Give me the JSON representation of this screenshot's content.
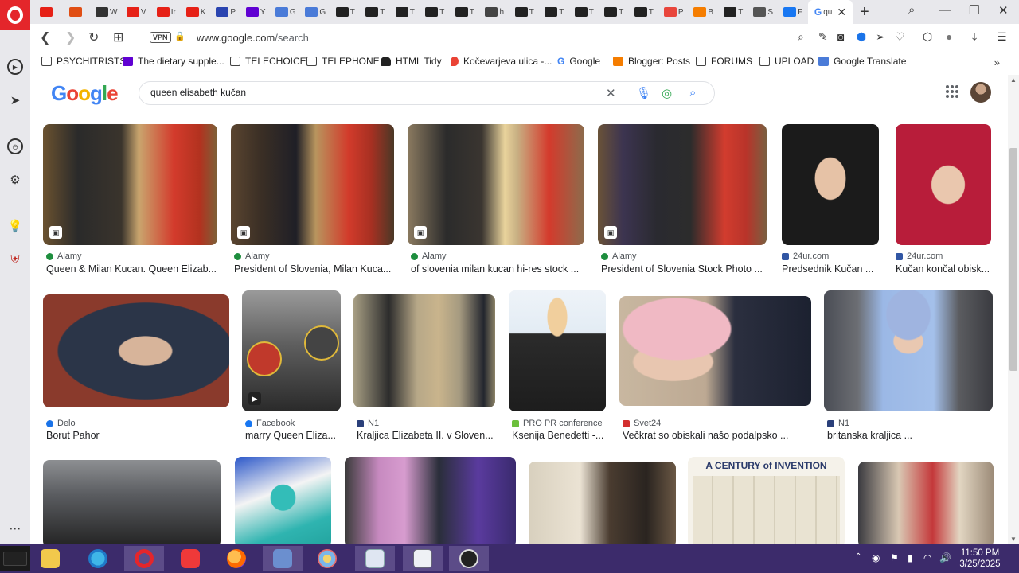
{
  "browser": {
    "active_tab": {
      "label": "qu"
    },
    "tabs": [
      {
        "icon": "youtube-icon",
        "label": "",
        "color": "#e62117"
      },
      {
        "icon": "shield-icon",
        "label": "",
        "color": "#e04e14"
      },
      {
        "icon": "wikipedia-icon",
        "label": "W",
        "color": "#333333"
      },
      {
        "icon": "youtube-icon",
        "label": "V",
        "color": "#e62117"
      },
      {
        "icon": "youtube-icon",
        "label": "Ir",
        "color": "#e62117"
      },
      {
        "icon": "youtube-icon",
        "label": "K",
        "color": "#e62117"
      },
      {
        "icon": "yahoo-icon",
        "label": "P",
        "color": "#2a44b0"
      },
      {
        "icon": "yahoo-icon",
        "label": "Y",
        "color": "#6001d2"
      },
      {
        "icon": "translate-icon",
        "label": "G",
        "color": "#4a7bd8"
      },
      {
        "icon": "translate-icon",
        "label": "G",
        "color": "#4a7bd8"
      },
      {
        "icon": "text-icon",
        "label": "T",
        "color": "#222222"
      },
      {
        "icon": "text-icon",
        "label": "T",
        "color": "#222222"
      },
      {
        "icon": "text-icon",
        "label": "T",
        "color": "#222222"
      },
      {
        "icon": "text-icon",
        "label": "T",
        "color": "#222222"
      },
      {
        "icon": "text-icon",
        "label": "T",
        "color": "#222222"
      },
      {
        "icon": "globe-icon",
        "label": "h",
        "color": "#444444"
      },
      {
        "icon": "text-icon",
        "label": "T",
        "color": "#222222"
      },
      {
        "icon": "text-icon",
        "label": "T",
        "color": "#222222"
      },
      {
        "icon": "text-icon",
        "label": "T",
        "color": "#222222"
      },
      {
        "icon": "text-icon",
        "label": "T",
        "color": "#222222"
      },
      {
        "icon": "text-icon",
        "label": "T",
        "color": "#222222"
      },
      {
        "icon": "photos-icon",
        "label": "P",
        "color": "#e8453c"
      },
      {
        "icon": "blogger-icon",
        "label": "B",
        "color": "#f57d00"
      },
      {
        "icon": "text-icon",
        "label": "T",
        "color": "#222222"
      },
      {
        "icon": "grid-icon",
        "label": "S",
        "color": "#555555"
      },
      {
        "icon": "facebook-icon",
        "label": "F",
        "color": "#1877f2"
      }
    ],
    "url": {
      "host": "www.google.com",
      "path": "/search"
    },
    "vpn_label": "VPN",
    "bookmarks": [
      {
        "label": "PSYCHITRISTS",
        "icon": "folder-icon"
      },
      {
        "label": "The dietary supple...",
        "icon": "yahoo-icon"
      },
      {
        "label": "TELECHOICE",
        "icon": "folder-icon"
      },
      {
        "label": "TELEPHONE",
        "icon": "folder-icon"
      },
      {
        "label": "HTML Tidy",
        "icon": "tidy-icon"
      },
      {
        "label": "Kočevarjeva ulica -...",
        "icon": "map-pin-icon"
      },
      {
        "label": "Google",
        "icon": "google-icon"
      },
      {
        "label": "Blogger: Posts",
        "icon": "blogger-icon"
      },
      {
        "label": "FORUMS",
        "icon": "folder-icon"
      },
      {
        "label": "UPLOAD",
        "icon": "folder-icon"
      },
      {
        "label": "Google Translate",
        "icon": "translate-icon"
      }
    ]
  },
  "google": {
    "logo_text": [
      "G",
      "o",
      "o",
      "g",
      "l",
      "e"
    ],
    "query": "queen elisabeth kučan"
  },
  "results": [
    {
      "source": "Alamy",
      "title": "Queen & Milan Kucan. Queen Elizab...",
      "source_color": "#1e8e3e"
    },
    {
      "source": "Alamy",
      "title": "President of Slovenia, Milan Kuca...",
      "source_color": "#1e8e3e"
    },
    {
      "source": "Alamy",
      "title": "of slovenia milan kucan hi-res stock ...",
      "source_color": "#1e8e3e"
    },
    {
      "source": "Alamy",
      "title": "President of Slovenia Stock Photo ...",
      "source_color": "#1e8e3e"
    },
    {
      "source": "24ur.com",
      "title": "Predsednik Kučan ...",
      "source_color": "#3156a4"
    },
    {
      "source": "24ur.com",
      "title": "Kučan končal obisk...",
      "source_color": "#3156a4"
    },
    {
      "source": "Delo",
      "title": "Borut Pahor",
      "source_color": "#1a73e8"
    },
    {
      "source": "Facebook",
      "title": "marry Queen Eliza...",
      "source_color": "#1877f2"
    },
    {
      "source": "N1",
      "title": "Kraljica Elizabeta II. v Sloven...",
      "source_color": "#2a3f7a"
    },
    {
      "source": "PRO PR conference",
      "title": "Ksenija Benedetti -...",
      "source_color": "#6cbf3c"
    },
    {
      "source": "Svet24",
      "title": "Večkrat so obiskali našo podalpsko ...",
      "source_color": "#d32f2f"
    },
    {
      "source": "N1",
      "title": "britanska kraljica ...",
      "source_color": "#2a3f7a"
    }
  ],
  "partial_result_banner": "A CENTURY of INVENTION",
  "taskbar": {
    "time": "11:50 PM",
    "date": "3/25/2025"
  }
}
